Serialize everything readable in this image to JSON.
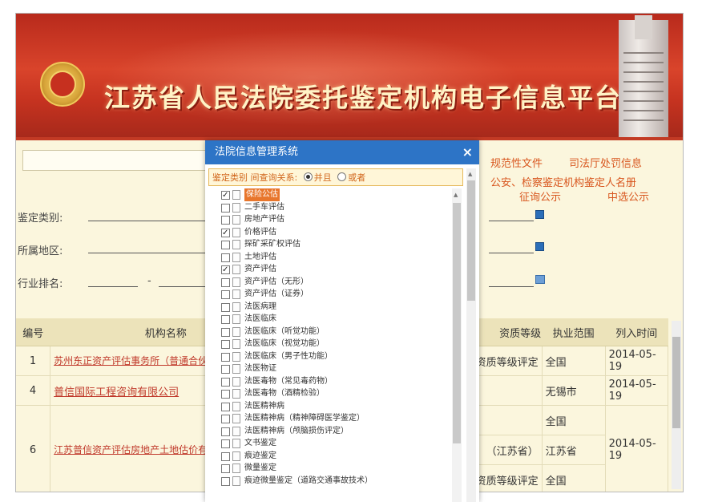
{
  "banner": {
    "title": "江苏省人民法院委托鉴定机构电子信息平台"
  },
  "top_links": [
    {
      "text": "规范性文件"
    },
    {
      "text": "司法厅处罚信息"
    },
    {
      "text": "公安、检察鉴定机构鉴定人名册"
    },
    {
      "text": "征询公示"
    },
    {
      "text": "中选公示"
    }
  ],
  "form": {
    "category_label": "鉴定类别:",
    "region_label": "所属地区:",
    "rank_label": "行业排名:",
    "rank_separator": "-"
  },
  "table": {
    "headers": [
      "编号",
      "机构名称",
      "资质等级",
      "执业范围",
      "列入时间"
    ],
    "rows": [
      {
        "no": "1",
        "name": "苏州东正资产评估事务所（普通合伙）业）",
        "grade": "资质等级评定",
        "scope": "全国",
        "date": "2014-05-19"
      },
      {
        "no": "4",
        "name": "普信国际工程咨询有限公司",
        "grade": "",
        "scope": "无锡市",
        "date": "2014-05-19"
      },
      {
        "no": "6",
        "name": "江苏普信资产评估房地产土地估价有限公司",
        "grade_lines": [
          "",
          "（江苏省）",
          "资质等级评定"
        ],
        "scope_lines": [
          "全国",
          "江苏省",
          "全国"
        ],
        "date": "2014-05-19"
      }
    ]
  },
  "modal": {
    "title": "法院信息管理系统",
    "close": "×",
    "filter": {
      "prefix": "鉴定类别 间查询关系:",
      "option_and": "并且",
      "option_or": "或者",
      "selected": "and"
    },
    "items": [
      {
        "label": "保险公估",
        "checked": true,
        "selected": true
      },
      {
        "label": "二手车评估",
        "checked": false
      },
      {
        "label": "房地产评估",
        "checked": false
      },
      {
        "label": "价格评估",
        "checked": true
      },
      {
        "label": "探矿采矿权评估",
        "checked": false
      },
      {
        "label": "土地评估",
        "checked": false
      },
      {
        "label": "资产评估",
        "checked": true
      },
      {
        "label": "资产评估（无形）",
        "checked": false
      },
      {
        "label": "资产评估（证券）",
        "checked": false
      },
      {
        "label": "法医病理",
        "checked": false
      },
      {
        "label": "法医临床",
        "checked": false
      },
      {
        "label": "法医临床（听觉功能）",
        "checked": false
      },
      {
        "label": "法医临床（视觉功能）",
        "checked": false
      },
      {
        "label": "法医临床（男子性功能）",
        "checked": false
      },
      {
        "label": "法医物证",
        "checked": false
      },
      {
        "label": "法医毒物（常见毒药物）",
        "checked": false
      },
      {
        "label": "法医毒物（酒精检验）",
        "checked": false
      },
      {
        "label": "法医精神病",
        "checked": false
      },
      {
        "label": "法医精神病（精神障碍医学鉴定）",
        "checked": false
      },
      {
        "label": "法医精神病（颅脑损伤评定）",
        "checked": false
      },
      {
        "label": "文书鉴定",
        "checked": false
      },
      {
        "label": "痕迹鉴定",
        "checked": false
      },
      {
        "label": "微量鉴定",
        "checked": false
      },
      {
        "label": "痕迹微量鉴定（道路交通事故技术）",
        "checked": false
      }
    ]
  }
}
